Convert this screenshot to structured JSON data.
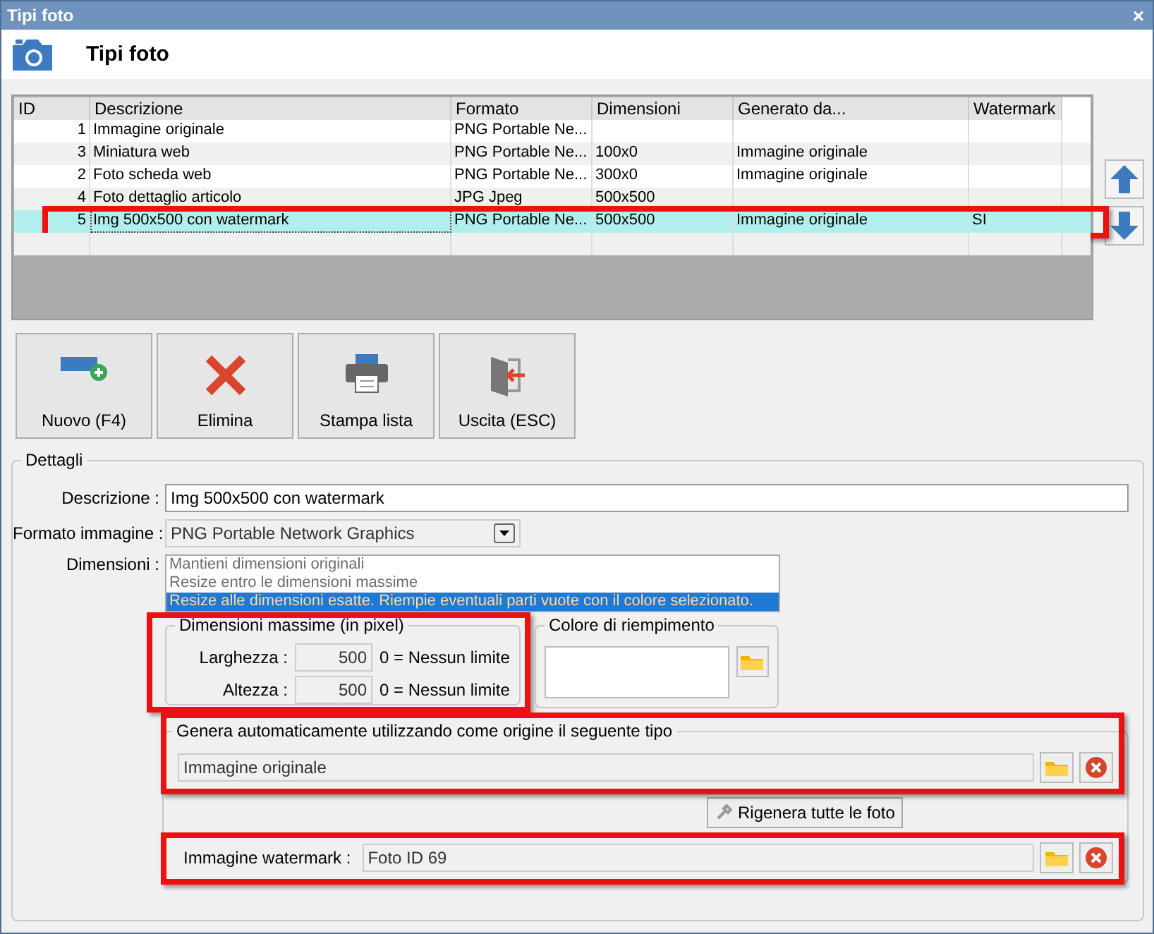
{
  "window": {
    "title": "Tipi foto",
    "close": "×"
  },
  "header": {
    "title": "Tipi foto"
  },
  "table": {
    "columns": [
      "ID",
      "Descrizione",
      "Formato",
      "Dimensioni",
      "Generato da...",
      "Watermark"
    ],
    "rows": [
      {
        "id": "1",
        "description": "Immagine originale",
        "format": "PNG Portable Ne...",
        "selected": false,
        "highlighted": false
      },
      {
        "id": "3",
        "description": "Miniatura web",
        "format": "PNG Portable Ne...",
        "dimensions": "100x0",
        "generated_from": "Immagine originale",
        "selected": false,
        "highlighted": false
      },
      {
        "id": "2",
        "description": "Foto scheda web",
        "format": "PNG Portable Ne...",
        "dimensions": "300x0",
        "generated_from": "Immagine originale",
        "selected": false,
        "highlighted": false
      },
      {
        "id": "4",
        "description": "Foto dettaglio articolo",
        "format": "JPG Jpeg",
        "dimensions": "500x500",
        "selected": false,
        "highlighted": false
      },
      {
        "id": "5",
        "description": "Img 500x500 con watermark",
        "format": "PNG Portable Ne...",
        "dimensions": "500x500",
        "generated_from": "Immagine originale",
        "watermark": "SI",
        "selected": true,
        "highlighted": true
      }
    ]
  },
  "toolbar": [
    {
      "label": "Nuovo (F4)",
      "kind": "new"
    },
    {
      "label": "Elimina",
      "kind": "delete"
    },
    {
      "label": "Stampa lista",
      "kind": "print"
    },
    {
      "label": "Uscita (ESC)",
      "kind": "exit"
    }
  ],
  "details": {
    "title": "Dettagli",
    "description": {
      "label": "Descrizione :",
      "value": "Img 500x500 con watermark"
    },
    "format": {
      "label": "Formato immagine :",
      "value": "PNG Portable Network Graphics",
      "disabled": true
    },
    "dimensions": {
      "label": "Dimensioni :",
      "options": [
        {
          "label": "Mantieni dimensioni originali",
          "selected": false
        },
        {
          "label": "Resize entro le dimensioni massime",
          "selected": false
        },
        {
          "label": "Resize alle dimensioni esatte. Riempie eventuali parti vuote con il colore selezionato.",
          "selected": true
        }
      ]
    },
    "max_size": {
      "title": "Dimensioni massime (in pixel)",
      "highlighted": true,
      "fields": [
        {
          "label": "Larghezza :",
          "value": "500",
          "hint": "0 = Nessun limite"
        },
        {
          "label": "Altezza :",
          "value": "500",
          "hint": "0 = Nessun limite"
        }
      ]
    },
    "fill_color": {
      "title": "Colore di riempimento"
    },
    "source": {
      "title": "Genera automaticamente utilizzando come origine il seguente tipo",
      "value": "Immagine originale",
      "highlighted": true
    },
    "regenerate_button": "Rigenera tutte le foto",
    "watermark": {
      "label": "Immagine watermark :",
      "value": "Foto ID 69",
      "highlighted": true
    }
  }
}
